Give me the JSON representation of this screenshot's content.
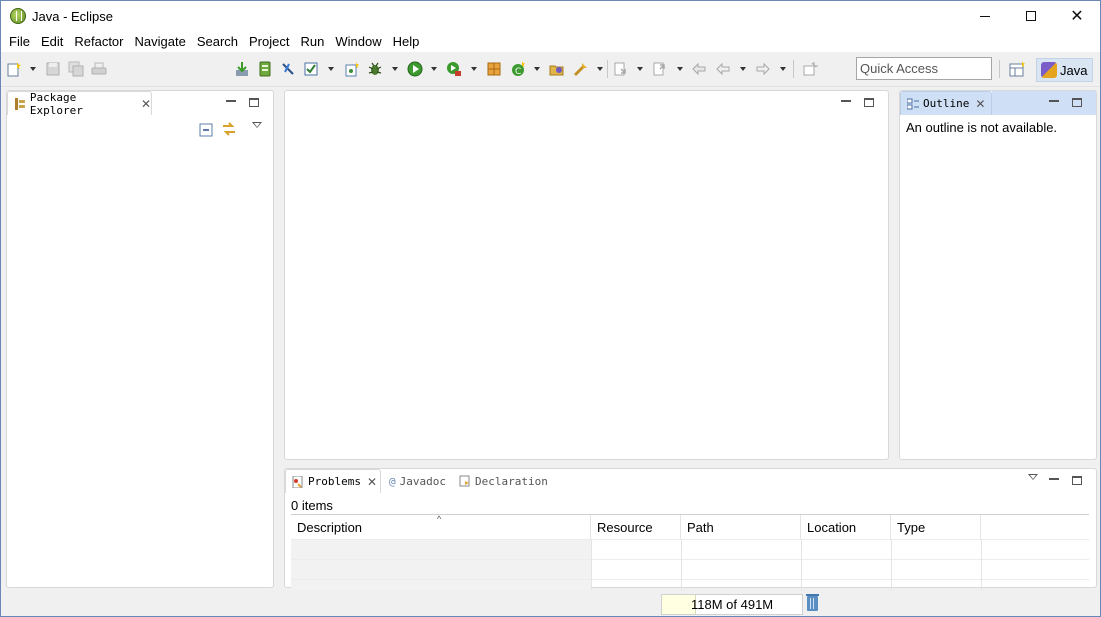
{
  "window": {
    "title": "Java - Eclipse",
    "controls": {
      "minimize": "minimize",
      "maximize": "maximize",
      "close": "✕"
    }
  },
  "menu": [
    "File",
    "Edit",
    "Refactor",
    "Navigate",
    "Search",
    "Project",
    "Run",
    "Window",
    "Help"
  ],
  "toolbar": {
    "quick_access_placeholder": "Quick Access",
    "perspective_label": "Java",
    "icons": [
      "new-wizard-icon",
      "save-icon",
      "save-all-icon",
      "print-icon",
      "download-icon",
      "server-icon",
      "toggle-mark-icon",
      "task-checkbox-icon",
      "new-java-project-icon",
      "debug-icon",
      "run-icon",
      "coverage-icon",
      "external-tools-icon",
      "new-java-class-icon",
      "open-type-icon",
      "search-icon",
      "next-annotation-icon",
      "previous-annotation-icon",
      "last-edit-location-icon",
      "back-icon",
      "forward-icon",
      "pin-editor-icon",
      "open-perspective-icon",
      "java-perspective-icon"
    ]
  },
  "package_explorer": {
    "tab_label": "Package Explorer",
    "icons": [
      "collapse-all-icon",
      "link-with-editor-icon",
      "view-menu-icon"
    ]
  },
  "outline": {
    "tab_label": "Outline",
    "message": "An outline is not available."
  },
  "bottom_panel": {
    "tabs": [
      {
        "label": "Problems",
        "active": true
      },
      {
        "label": "Javadoc",
        "active": false
      },
      {
        "label": "Declaration",
        "active": false
      }
    ],
    "items_count": "0 items",
    "columns": [
      "Description",
      "Resource",
      "Path",
      "Location",
      "Type"
    ],
    "sort_indicator": "^"
  },
  "status": {
    "heap_text": "118M of 491M",
    "heap_used_fraction": 0.24
  },
  "colors": {
    "titlebar": "#ffffff",
    "workbench": "#f0f0f0",
    "active_tab_blue": "#cfe0f6",
    "heap_fill": "#ffffe1"
  }
}
